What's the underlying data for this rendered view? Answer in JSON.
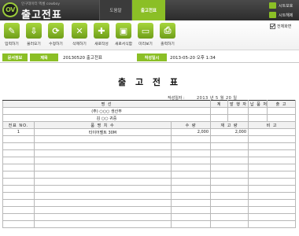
{
  "header": {
    "brand_sub": "인구데이터 엑셀 cowboy",
    "title": "출고전표",
    "tabs": [
      {
        "label": "도움말",
        "active": false
      },
      {
        "label": "출고전표",
        "active": true
      }
    ],
    "sheet_protect": "시트보호",
    "sheet_unprotect": "시트해제"
  },
  "toolbar": {
    "buttons": [
      {
        "label": "입력하기",
        "icon": "pencil-icon",
        "glyph": "✎"
      },
      {
        "label": "불러오기",
        "icon": "download-icon",
        "glyph": "⇩"
      },
      {
        "label": "수정하기",
        "icon": "refresh-icon",
        "glyph": "⟳"
      },
      {
        "label": "삭제하기",
        "icon": "trash-icon",
        "glyph": "✕"
      },
      {
        "label": "새로작성",
        "icon": "new-doc-icon",
        "glyph": "✚"
      },
      {
        "label": "새로서식함",
        "icon": "open-folder-icon",
        "glyph": "▣"
      },
      {
        "label": "미리보기",
        "icon": "monitor-icon",
        "glyph": "▭"
      },
      {
        "label": "출력하기",
        "icon": "printer-icon",
        "glyph": "⎙"
      }
    ],
    "fullscreen_label": "전체화면"
  },
  "info": {
    "docinfo_label": "문서정보",
    "subject_label": "제목",
    "subject_value": "20130520 출고전표",
    "created_label": "작성일시",
    "created_value": "2013-05-20  오후 1:34"
  },
  "document": {
    "title": "출 고 전 표",
    "written_label": "작성일자 :",
    "written_date": "2013 년   5 월   20 일",
    "header_row": {
      "c1": "명                  선",
      "c2": "계",
      "c3": "발 행 자",
      "c4": "납 품 처",
      "c5": "출  고"
    },
    "company": "(주) ○○○  생산부",
    "person": "김 ○○  귀중",
    "columns": {
      "no": "전표 NO.",
      "item": "품       명       치       수",
      "qty": "수   량",
      "stock": "재 고 량",
      "note": "비    고"
    },
    "rows": [
      {
        "no": "1",
        "item": "타이어벨트 30M",
        "qty": "2,000",
        "stock": "2,000",
        "note": ""
      }
    ]
  },
  "colors": {
    "accent": "#8bbf26",
    "header_bg": "#333333"
  }
}
